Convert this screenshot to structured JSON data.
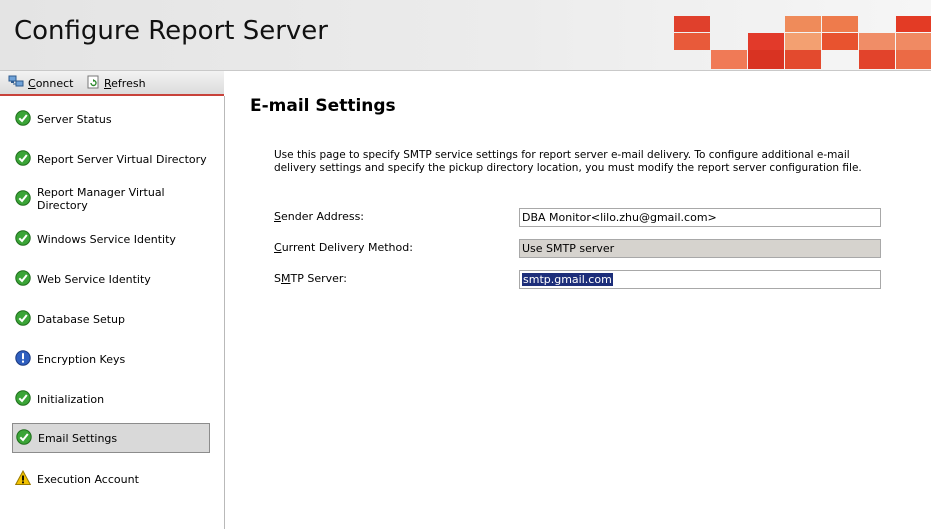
{
  "app": {
    "title": "Configure Report Server"
  },
  "toolbar": {
    "connect_label": "Connect",
    "refresh_label": "Refresh"
  },
  "sidebar": {
    "items": [
      {
        "label": "Server Status",
        "status": "ok"
      },
      {
        "label": "Report Server Virtual Directory",
        "status": "ok"
      },
      {
        "label": "Report Manager Virtual Directory",
        "status": "ok"
      },
      {
        "label": "Windows Service Identity",
        "status": "ok"
      },
      {
        "label": "Web Service Identity",
        "status": "ok"
      },
      {
        "label": "Database Setup",
        "status": "ok"
      },
      {
        "label": "Encryption Keys",
        "status": "info"
      },
      {
        "label": "Initialization",
        "status": "ok"
      },
      {
        "label": "Email Settings",
        "status": "ok",
        "selected": true
      },
      {
        "label": "Execution Account",
        "status": "warning"
      }
    ]
  },
  "main": {
    "title": "E-mail Settings",
    "description": "Use this page to specify SMTP service settings for report server e-mail delivery. To configure additional e-mail delivery settings and specify the pickup directory location, you must modify the report server configuration file.",
    "fields": {
      "sender_label": "Sender Address:",
      "sender_value": "DBA Monitor<lilo.zhu@gmail.com>",
      "delivery_label": "Current Delivery Method:",
      "delivery_value": "Use SMTP server",
      "smtp_label": "SMTP Server:",
      "smtp_value": "smtp.gmail.com"
    }
  },
  "colors": {
    "accent_red": "#e0402c",
    "accent_orange": "#ef7d4a",
    "ok_green": "#3aa436",
    "info_blue": "#2f5fbf",
    "warn_yellow": "#f2c200",
    "selection_blue": "#1d2e7a"
  },
  "icons": {
    "connect": "connect-icon",
    "refresh": "refresh-icon",
    "ok": "check-circle-icon",
    "info": "info-circle-icon",
    "warning": "warning-triangle-icon"
  }
}
